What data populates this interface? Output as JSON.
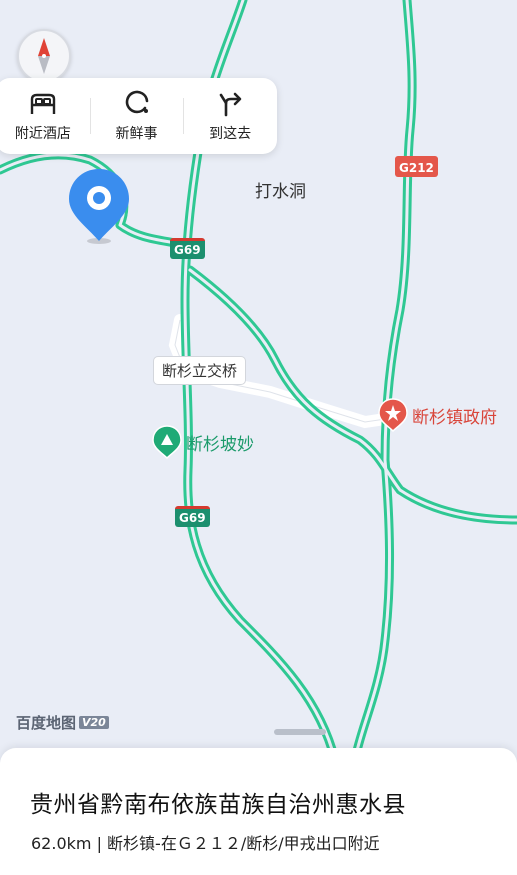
{
  "toolbar": {
    "items": [
      {
        "label": "附近酒店",
        "icon": "bed-icon"
      },
      {
        "label": "新鲜事",
        "icon": "refresh-icon"
      },
      {
        "label": "到这去",
        "icon": "route-arrow-icon"
      }
    ]
  },
  "map": {
    "labels": {
      "dashuidong": "打水洞",
      "bridge": "断杉立交桥",
      "poi_park": "断杉坡妙",
      "poi_gov": "断杉镇政府"
    },
    "road_badges": {
      "g69_top": "G69",
      "g69_bottom": "G69",
      "g212": "G212"
    },
    "colors": {
      "background": "#e9edf6",
      "highway": "#2fc893",
      "minor_road": "#ffffff",
      "location_pin": "#3a8dee",
      "gov_pin": "#e4574a",
      "park_pin": "#1faa76"
    }
  },
  "brand": {
    "name": "百度地图",
    "version": "V20"
  },
  "place": {
    "title": "贵州省黔南布依族苗族自治州惠水县",
    "subtitle": "62.0km | 断杉镇-在Ｇ２１２/断杉/甲戎出口附近"
  }
}
